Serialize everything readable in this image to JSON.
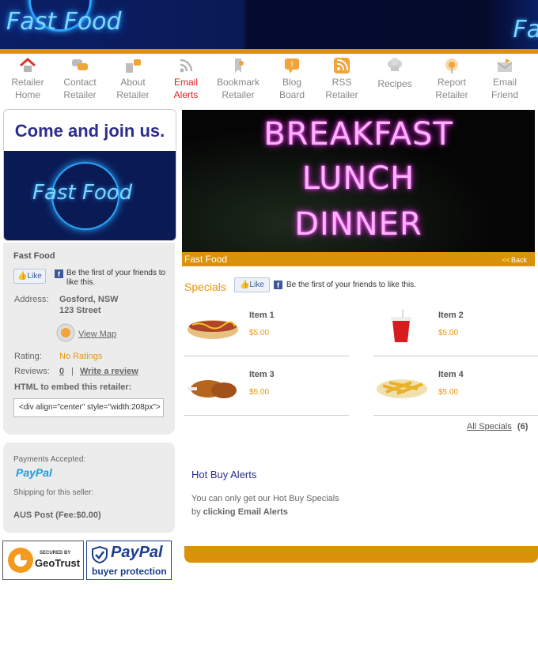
{
  "banner": {
    "logo_text": "Fast Food",
    "logo_text_right": "Fa"
  },
  "nav": [
    {
      "label1": "Retailer",
      "label2": "Home",
      "icon": "home-icon"
    },
    {
      "label1": "Contact",
      "label2": "Retailer",
      "icon": "chat-icon"
    },
    {
      "label1": "About",
      "label2": "Retailer",
      "icon": "people-icon"
    },
    {
      "label1": "Email",
      "label2": "Alerts",
      "icon": "rss-icon"
    },
    {
      "label1": "Bookmark",
      "label2": "Retailer",
      "icon": "bookmark-icon"
    },
    {
      "label1": "Blog",
      "label2": "Board",
      "icon": "blog-icon"
    },
    {
      "label1": "RSS",
      "label2": "Retailer",
      "icon": "rss-feed-icon"
    },
    {
      "label1": "Recipes",
      "label2": "",
      "icon": "chef-hat-icon"
    },
    {
      "label1": "Report",
      "label2": "Retailer",
      "icon": "report-icon"
    },
    {
      "label1": "Email",
      "label2": "Friend",
      "icon": "envelope-icon"
    }
  ],
  "join": {
    "title": "Come and join us.",
    "logo_text": "Fast Food"
  },
  "retailer": {
    "name": "Fast Food",
    "like_label": "Like",
    "like_text": "Be the first of your friends to like this.",
    "address_label": "Address:",
    "address_line1": "Gosford, NSW",
    "address_line2": "123 Street",
    "view_map": "View Map",
    "rating_label": "Rating:",
    "rating_value": "No Ratings",
    "reviews_label": "Reviews:",
    "reviews_count": "0",
    "reviews_sep": "|",
    "write_review": "Write a review",
    "embed_label": "HTML to embed this retailer:",
    "embed_code": "<div align=\"center\" style=\"width:208px\">"
  },
  "payments": {
    "accepted_label": "Payments Accepted:",
    "paypal_text": "PayPal",
    "shipping_label": "Shipping for this seller:",
    "shipping_value": "AUS Post (Fee:$0.00)"
  },
  "badges": {
    "geotrust_top": "SECURED BY",
    "geotrust_name": "GeoTrust",
    "paypal_name": "PayPal",
    "paypal_sub": "buyer protection"
  },
  "hero": {
    "neon_line1": "BREAKFAST",
    "neon_line2": "LUNCH",
    "neon_line3": "DINNER",
    "bar_title": "Fast Food",
    "back_arrows": "<<",
    "back_label": "Back"
  },
  "specials": {
    "title": "Specials",
    "like_label": "Like",
    "like_text": "Be the first of your friends to like this.",
    "items": [
      {
        "name": "Item 1",
        "price": "$5.00",
        "image": "hotdog"
      },
      {
        "name": "Item 2",
        "price": "$5.00",
        "image": "soda-cup"
      },
      {
        "name": "Item 3",
        "price": "$5.00",
        "image": "chicken"
      },
      {
        "name": "Item 4",
        "price": "$5.00",
        "image": "fries"
      }
    ],
    "all_label": "All Specials",
    "all_count": "(6)"
  },
  "hot_buy": {
    "title": "Hot Buy Alerts",
    "text_line1": "You can only get our Hot Buy Specials",
    "text_line2_prefix": "by",
    "text_line2_link": "clicking Email Alerts"
  }
}
